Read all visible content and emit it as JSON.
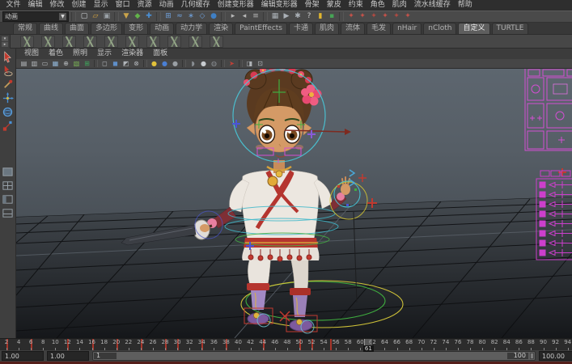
{
  "colors": {
    "picker_magenta": "#cc3fcc",
    "keyframe_red": "#a8352a",
    "control_cyan": "#49c8d8",
    "control_green": "#3fae3f",
    "control_yellow": "#d4c430",
    "viewport_top": "#5d666f"
  },
  "menubar": {
    "items": [
      "文件",
      "编辑",
      "修改",
      "创建",
      "显示",
      "窗口",
      "资源",
      "动画",
      "几何缓存",
      "创建变形器",
      "编辑变形器",
      "骨架",
      "蒙皮",
      "约束",
      "角色",
      "肌肉",
      "流水线缓存",
      "帮助"
    ]
  },
  "statusline": {
    "menuset": "动画",
    "dropdown_arrow": "▼",
    "icons": [
      {
        "name": "new-scene-icon",
        "glyph": "▢",
        "color": "#cfd3d6"
      },
      {
        "name": "open-scene-icon",
        "glyph": "▱",
        "color": "#d7a43f"
      },
      {
        "name": "save-scene-icon",
        "glyph": "▣",
        "color": "#9aa0a6"
      },
      {
        "name": "divider"
      },
      {
        "name": "select-by-hierarchy-icon",
        "glyph": "▼",
        "color": "#c9a34a"
      },
      {
        "name": "select-by-object-icon",
        "glyph": "◆",
        "color": "#62b34a"
      },
      {
        "name": "select-by-component-icon",
        "glyph": "✚",
        "color": "#4a8fd4"
      },
      {
        "name": "divider"
      },
      {
        "name": "snap-to-grid-icon",
        "glyph": "⊞",
        "color": "#6f9fd8"
      },
      {
        "name": "snap-to-curve-icon",
        "glyph": "≈",
        "color": "#6f9fd8"
      },
      {
        "name": "snap-to-point-icon",
        "glyph": "∗",
        "color": "#6f9fd8"
      },
      {
        "name": "snap-to-plane-icon",
        "glyph": "◇",
        "color": "#6f9fd8"
      },
      {
        "name": "make-live-icon",
        "glyph": "●",
        "color": "#3f7fc4"
      },
      {
        "name": "divider"
      },
      {
        "name": "input-connections-icon",
        "glyph": "▸",
        "color": "#b8b8b8"
      },
      {
        "name": "output-connections-icon",
        "glyph": "◂",
        "color": "#b8b8b8"
      },
      {
        "name": "construction-history-icon",
        "glyph": "≡",
        "color": "#b8b8b8"
      },
      {
        "name": "divider"
      },
      {
        "name": "render-view-icon",
        "glyph": "▦",
        "color": "#aab0b6"
      },
      {
        "name": "ipr-render-icon",
        "glyph": "▶",
        "color": "#aab0b6"
      },
      {
        "name": "render-settings-icon",
        "glyph": "✱",
        "color": "#aab0b6"
      },
      {
        "name": "help-line-icon",
        "glyph": "?",
        "color": "#d0d0d0"
      },
      {
        "name": "lock-icon",
        "glyph": "▮",
        "color": "#e0b62f"
      },
      {
        "name": "selection-highlight-icon",
        "glyph": "▪",
        "color": "#46a356"
      },
      {
        "name": "divider"
      },
      {
        "name": "set-key-icon",
        "glyph": "✦",
        "color": "#c4524a"
      },
      {
        "name": "set-key-options-icon",
        "glyph": "✦",
        "color": "#c4524a"
      },
      {
        "name": "set-breakdown-icon",
        "glyph": "✦",
        "color": "#b04a42"
      },
      {
        "name": "mute-channel-icon",
        "glyph": "✦",
        "color": "#c4524a"
      },
      {
        "name": "unmute-channel-icon",
        "glyph": "✦",
        "color": "#b04a42"
      },
      {
        "name": "hold-keys-icon",
        "glyph": "✦",
        "color": "#c4524a"
      }
    ]
  },
  "shelf": {
    "selected": "自定义",
    "tabs": [
      "常规",
      "曲线",
      "曲面",
      "多边形",
      "变形",
      "动画",
      "动力学",
      "渲染",
      "PaintEffects",
      "卡通",
      "肌肉",
      "流体",
      "毛发",
      "nHair",
      "nCloth",
      "自定义",
      "TURTLE"
    ],
    "button_count": 10
  },
  "panel": {
    "menus": [
      "视图",
      "着色",
      "照明",
      "显示",
      "渲染器",
      "面板"
    ],
    "icons": [
      {
        "name": "select-camera-icon",
        "glyph": "▤",
        "color": "#b8bcc0"
      },
      {
        "name": "camera-attributes-icon",
        "glyph": "▥",
        "color": "#b8bcc0"
      },
      {
        "name": "bookmark-icon",
        "glyph": "▭",
        "color": "#b8bcc0"
      },
      {
        "name": "image-plane-icon",
        "glyph": "▦",
        "color": "#8fb3d4"
      },
      {
        "name": "two-d-pan-zoom-icon",
        "glyph": "⊕",
        "color": "#b8bcc0"
      },
      {
        "name": "grease-pencil-icon",
        "glyph": "▧",
        "color": "#79b356"
      },
      {
        "name": "grid-icon",
        "glyph": "⊞",
        "color": "#3da65c"
      },
      {
        "name": "divider"
      },
      {
        "name": "film-gate-icon",
        "glyph": "◻",
        "color": "#b0b4b8"
      },
      {
        "name": "resolution-gate-icon",
        "glyph": "◼",
        "color": "#5f8fc9"
      },
      {
        "name": "gate-mask-icon",
        "glyph": "◩",
        "color": "#b0b4b8"
      },
      {
        "name": "field-chart-icon",
        "glyph": "⊗",
        "color": "#b0b4b8"
      },
      {
        "name": "divider"
      },
      {
        "name": "default-lighting-icon",
        "glyph": "●",
        "color": "#e2c23a"
      },
      {
        "name": "all-lights-icon",
        "glyph": "●",
        "color": "#4a7fd4"
      },
      {
        "name": "no-lights-icon",
        "glyph": "●",
        "color": "#9a9fa4"
      },
      {
        "name": "divider"
      },
      {
        "name": "shadows-icon",
        "glyph": "◗",
        "color": "#8a8f94"
      },
      {
        "name": "textured-icon",
        "glyph": "●",
        "color": "#c8ccd0"
      },
      {
        "name": "wireframe-on-shaded-icon",
        "glyph": "◍",
        "color": "#8a8f94"
      },
      {
        "name": "divider"
      },
      {
        "name": "isolate-select-icon",
        "glyph": "➤",
        "color": "#c04038"
      },
      {
        "name": "divider"
      },
      {
        "name": "xray-icon",
        "glyph": "◨",
        "color": "#b0b4b8"
      },
      {
        "name": "backface-culling-icon",
        "glyph": "⊡",
        "color": "#b0b4b8"
      }
    ]
  },
  "timeline": {
    "ticks": [
      2,
      4,
      6,
      8,
      10,
      12,
      14,
      16,
      18,
      20,
      22,
      24,
      26,
      28,
      30,
      32,
      34,
      36,
      38,
      40,
      42,
      44,
      46,
      48,
      50,
      52,
      54,
      56,
      58,
      60,
      62,
      64,
      66,
      68,
      70,
      72,
      74,
      76,
      78,
      80,
      82,
      84,
      86,
      88,
      90,
      92,
      94
    ],
    "keyframes": [
      2,
      6,
      12,
      16,
      20,
      24,
      28,
      30,
      34,
      38,
      44,
      50,
      52,
      55
    ],
    "current_frame": "61"
  },
  "rangeslider": {
    "anim_start": "1.00",
    "play_start": "1.00",
    "bar_start": "1",
    "bar_end": "100",
    "anim_end": "100.00"
  }
}
